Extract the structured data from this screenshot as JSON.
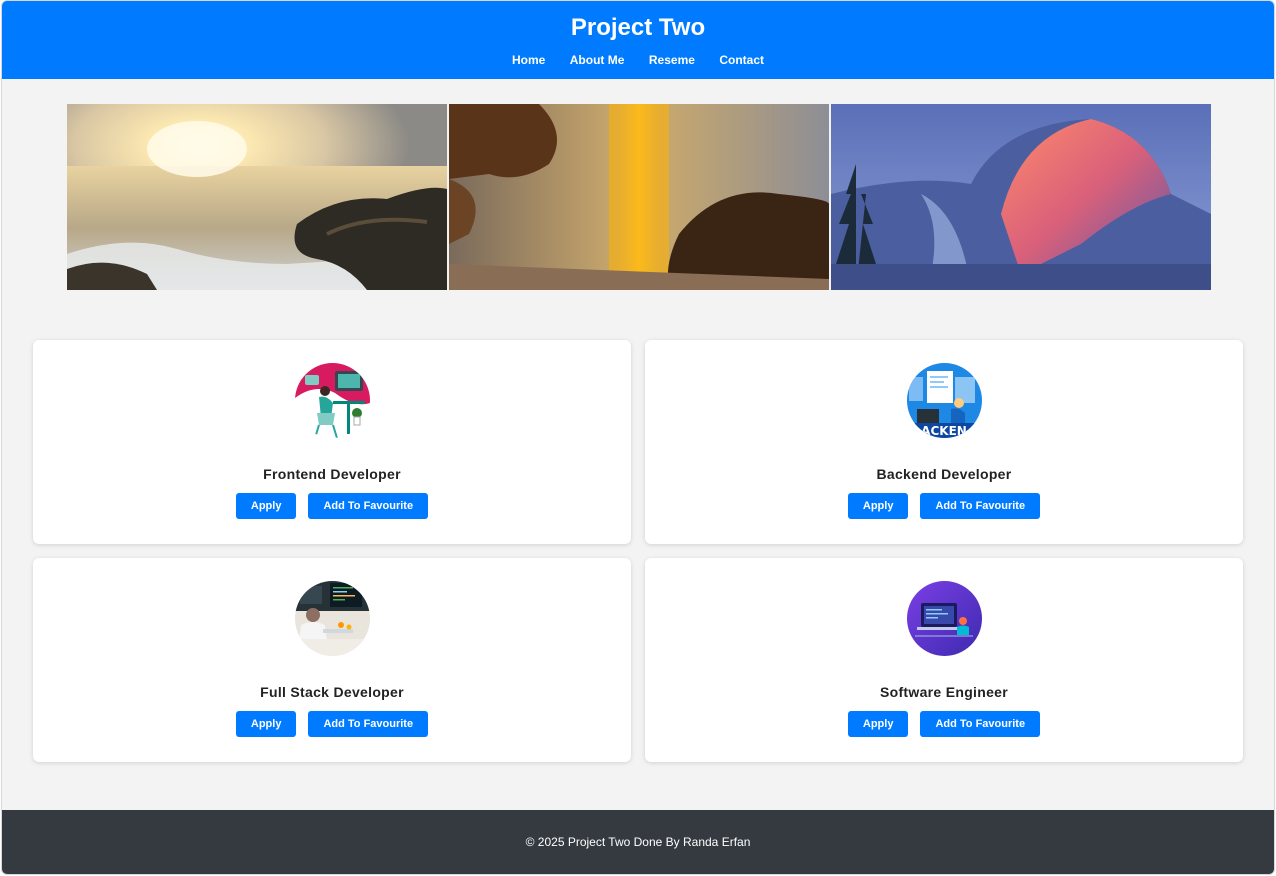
{
  "header": {
    "title": "Project Two",
    "nav": [
      "Home",
      "About Me",
      "Reseme",
      "Contact"
    ]
  },
  "gallery": [
    "sunset-coast-photo",
    "sunset-water-photo",
    "half-dome-photo"
  ],
  "cards": [
    {
      "title": "Frontend Developer",
      "apply": "Apply",
      "favourite": "Add To Favourite",
      "image": "frontend-developer-illustration"
    },
    {
      "title": "Backend Developer",
      "apply": "Apply",
      "favourite": "Add To Favourite",
      "image": "backend-developer-illustration",
      "image_text": "ACKEN"
    },
    {
      "title": "Full Stack Developer",
      "apply": "Apply",
      "favourite": "Add To Favourite",
      "image": "full-stack-developer-photo"
    },
    {
      "title": "Software Engineer",
      "apply": "Apply",
      "favourite": "Add To Favourite",
      "image": "software-engineer-illustration"
    }
  ],
  "footer": {
    "text": "© 2025 Project Two Done By Randa Erfan"
  },
  "colors": {
    "primary": "#007bff",
    "footer": "#343a40",
    "background": "#f3f3f3"
  }
}
